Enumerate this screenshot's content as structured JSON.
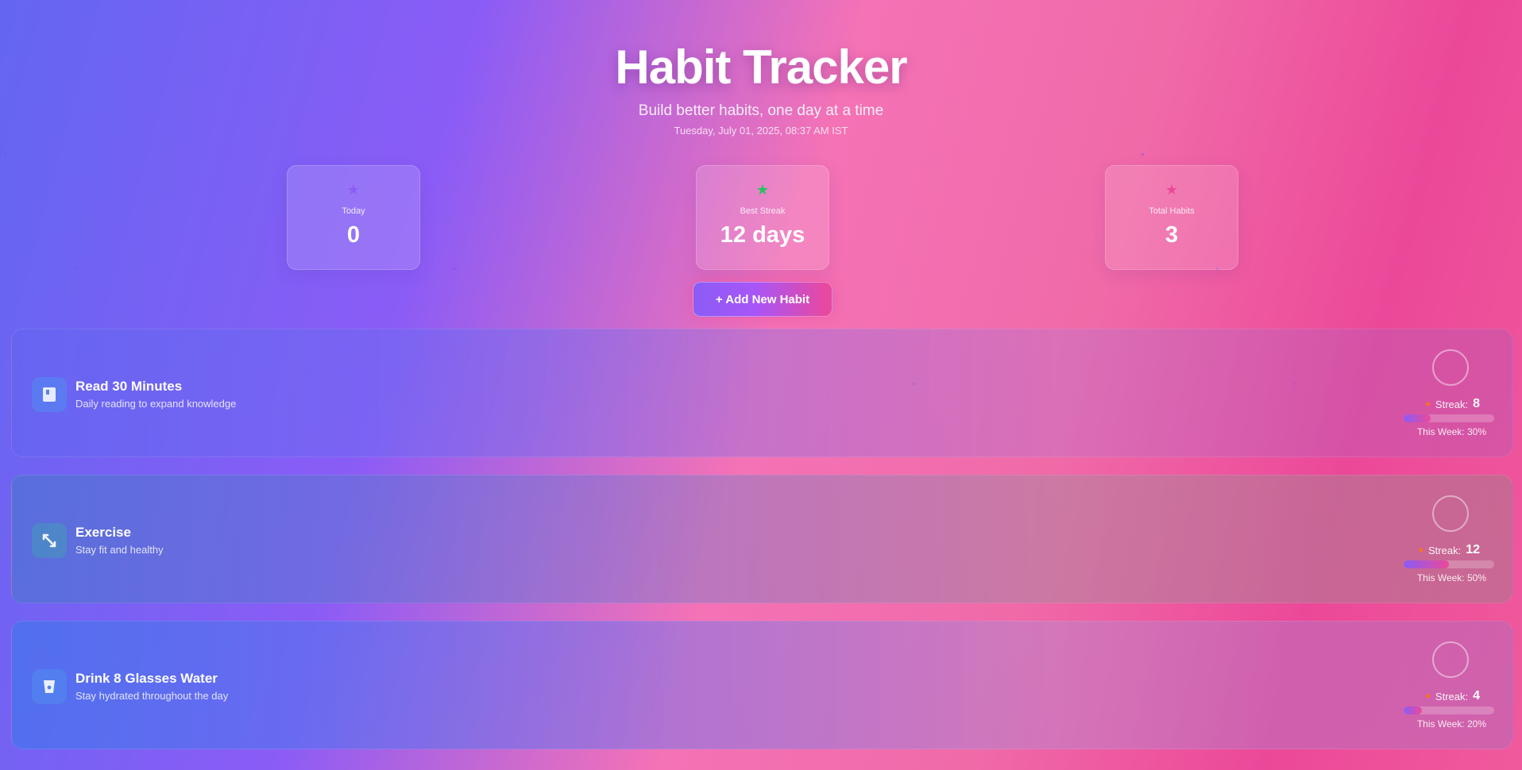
{
  "header": {
    "title": "Habit Tracker",
    "subtitle": "Build better habits, one day at a time",
    "datetime": "Tuesday, July 01, 2025, 08:37 AM IST"
  },
  "stats": [
    {
      "label": "Today",
      "value": "0",
      "icon": "star-icon",
      "color": "#8b5cf6"
    },
    {
      "label": "Best Streak",
      "value": "12 days",
      "icon": "star-icon",
      "color": "#22c55e"
    },
    {
      "label": "Total Habits",
      "value": "3",
      "icon": "star-icon",
      "color": "#ec4899"
    }
  ],
  "add_button": {
    "label": "+ Add New Habit"
  },
  "habits": [
    {
      "name": "Read 30 Minutes",
      "description": "Daily reading to expand knowledge",
      "icon": "book-icon",
      "streak_label": "Streak:",
      "streak": "8",
      "week_label": "This Week: 30%",
      "week_percent": 30
    },
    {
      "name": "Exercise",
      "description": "Stay fit and healthy",
      "icon": "dumbbell-icon",
      "streak_label": "Streak:",
      "streak": "12",
      "week_label": "This Week: 50%",
      "week_percent": 50
    },
    {
      "name": "Drink 8 Glasses Water",
      "description": "Stay hydrated throughout the day",
      "icon": "glass-icon",
      "streak_label": "Streak:",
      "streak": "4",
      "week_label": "This Week: 20%",
      "week_percent": 20
    }
  ],
  "colors": {
    "accent_purple": "#8b5cf6",
    "accent_pink": "#ec4899",
    "streak_fire": "#f97316",
    "best_streak_star": "#22c55e"
  }
}
